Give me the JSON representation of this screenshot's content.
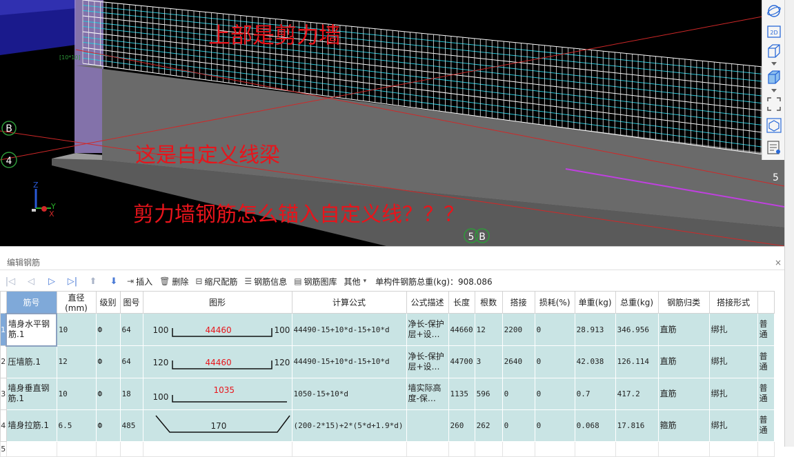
{
  "viewport": {
    "annotations": {
      "top": "上部是剪力墙",
      "middle": "这是自定义线梁",
      "bottom": "剪力墙钢筋怎么锚入自定义线？？？"
    },
    "axis_markers": [
      "B",
      "4",
      "5",
      "B",
      "5"
    ],
    "axis_small_label": "[10*10]",
    "axis_triad": {
      "z": "Z",
      "y": "Y",
      "x": "X"
    }
  },
  "right_toolbar": {
    "icons": [
      "orbit-icon",
      "2d-view-icon",
      "3d-box-icon",
      "solid-box-icon",
      "fullscreen-icon",
      "display-toggle-icon",
      "properties-icon"
    ],
    "twod_label": "2D"
  },
  "panel": {
    "title": "编辑钢筋",
    "close": "×",
    "toolbar": {
      "insert": "插入",
      "delete": "删除",
      "scale": "缩尺配筋",
      "info": "钢筋信息",
      "library": "钢筋图库",
      "other": "其他",
      "total_label": "单构件钢筋总重(kg)：908.086"
    }
  },
  "table": {
    "columns": [
      "筋号",
      "直径(mm)",
      "级别",
      "图号",
      "图形",
      "计算公式",
      "公式描述",
      "长度",
      "根数",
      "搭接",
      "损耗(%)",
      "单重(kg)",
      "总重(kg)",
      "钢筋归类",
      "搭接形式",
      ""
    ],
    "rows": [
      {
        "num": "1",
        "name": "墙身水平钢筋.1",
        "dia": "10",
        "grade": "Ф",
        "fig": "64",
        "shape_left": "100",
        "shape_mid": "44460",
        "shape_right": "100",
        "formula": "44490-15+10*d-15+10*d",
        "desc": "净长-保护层+设…",
        "len": "44660",
        "count": "12",
        "lap": "2200",
        "loss": "0",
        "unit_w": "28.913",
        "total_w": "346.956",
        "cls": "直筋",
        "lap_type": "绑扎",
        "extra": "普通"
      },
      {
        "num": "2",
        "name": "压墙筋.1",
        "dia": "12",
        "grade": "Ф",
        "fig": "64",
        "shape_left": "120",
        "shape_mid": "44460",
        "shape_right": "120",
        "formula": "44490-15+10*d-15+10*d",
        "desc": "净长-保护层+设…",
        "len": "44700",
        "count": "3",
        "lap": "2640",
        "loss": "0",
        "unit_w": "42.038",
        "total_w": "126.114",
        "cls": "直筋",
        "lap_type": "绑扎",
        "extra": "普通"
      },
      {
        "num": "3",
        "name": "墙身垂直钢筋.1",
        "dia": "10",
        "grade": "Ф",
        "fig": "18",
        "shape_left": "100",
        "shape_mid": "1035",
        "shape_right": "",
        "formula": "1050-15+10*d",
        "desc": "墙实际高度-保…",
        "len": "1135",
        "count": "596",
        "lap": "0",
        "loss": "0",
        "unit_w": "0.7",
        "total_w": "417.2",
        "cls": "直筋",
        "lap_type": "绑扎",
        "extra": "普通"
      },
      {
        "num": "4",
        "name": "墙身拉筋.1",
        "dia": "6.5",
        "grade": "Ф",
        "fig": "485",
        "shape_left": "",
        "shape_mid": "170",
        "shape_right": "",
        "formula": "(200-2*15)+2*(5*d+1.9*d)",
        "desc": "",
        "len": "260",
        "count": "262",
        "lap": "0",
        "loss": "0",
        "unit_w": "0.068",
        "total_w": "17.816",
        "cls": "箍筋",
        "lap_type": "绑扎",
        "extra": "普通"
      }
    ],
    "empty_row_num": "5"
  }
}
